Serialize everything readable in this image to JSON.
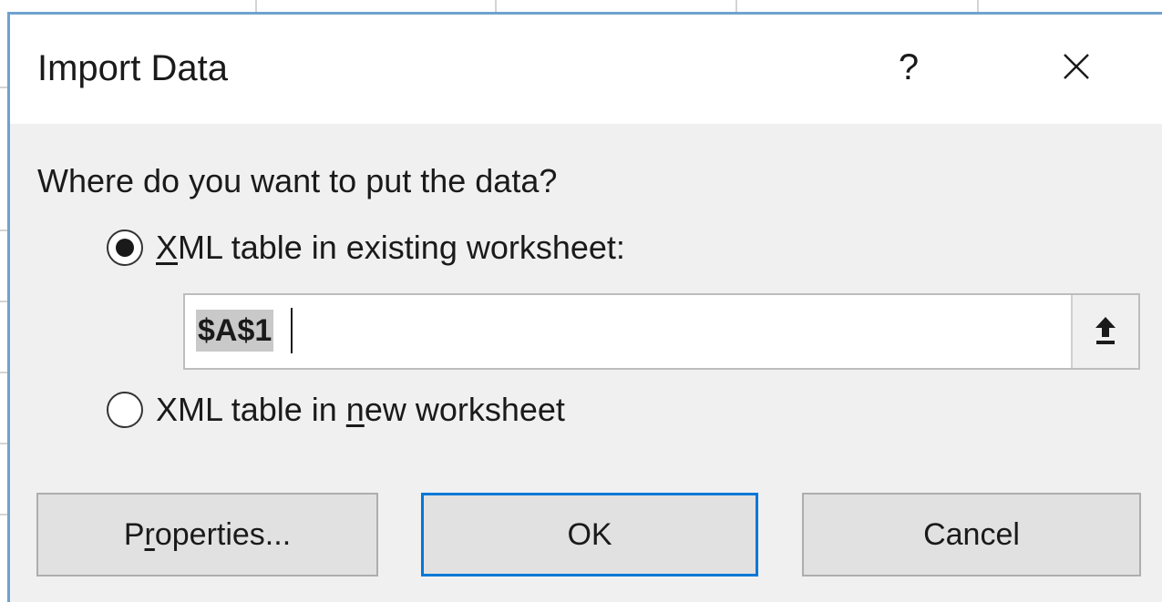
{
  "dialog": {
    "title": "Import Data",
    "help_symbol": "?",
    "close_icon": "close-icon"
  },
  "prompt": {
    "question": "Where do you want to put the data?"
  },
  "options": {
    "existing": {
      "prefix_underlined": "X",
      "rest": "ML table in existing worksheet:",
      "selected": true
    },
    "range_value": "$A$1",
    "collapse_icon": "collapse-dialog-icon",
    "new_sheet": {
      "before": "XML table in ",
      "underlined": "n",
      "after": "ew worksheet",
      "selected": false
    }
  },
  "buttons": {
    "properties": {
      "before": "P",
      "underlined": "r",
      "after": "operties..."
    },
    "ok": "OK",
    "cancel": "Cancel"
  },
  "colors": {
    "accent": "#0078d7",
    "dialog_border": "#6fa2cf",
    "dialog_bg": "#f0f0f0"
  }
}
